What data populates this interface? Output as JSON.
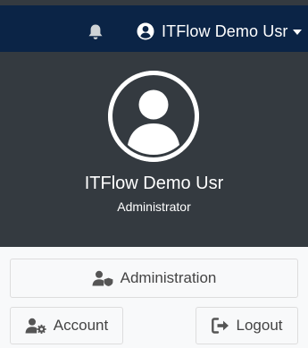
{
  "navbar": {
    "notifications_icon": "bell-icon",
    "user_icon": "user-circle-icon",
    "user_name": "ITFlow Demo Usr"
  },
  "profile": {
    "avatar_icon": "user-avatar-icon",
    "name": "ITFlow Demo Usr",
    "role": "Administrator"
  },
  "footer": {
    "administration_label": "Administration",
    "administration_icon": "user-shield-icon",
    "account_label": "Account",
    "account_icon": "user-cog-icon",
    "logout_label": "Logout",
    "logout_icon": "sign-out-icon"
  },
  "colors": {
    "navbar_bg": "#0b2446",
    "header_bg": "#343a40",
    "footer_bg": "#f8f9fa",
    "icon_gray": "#cfd3d6",
    "button_text": "#444444"
  }
}
